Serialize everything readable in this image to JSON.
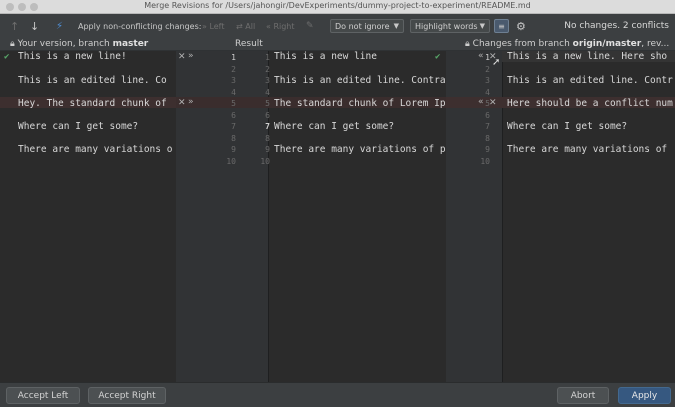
{
  "window": {
    "title": "Merge Revisions for /Users/jahongir/DevExperiments/dummy-project-to-experiment/README.md"
  },
  "toolbar": {
    "apply_non_conflicting": "Apply non-conflicting changes:",
    "left": "Left",
    "all": "All",
    "right": "Right",
    "ignore_select": "Do not ignore",
    "highlight_select": "Highlight words",
    "status": "No changes. 2 conflicts"
  },
  "headers": {
    "left_prefix": "Your version, branch ",
    "left_branch": "master",
    "center": "Result",
    "right_prefix": "Changes from branch ",
    "right_branch": "origin/master",
    "right_suffix": ", rev..."
  },
  "left_pane": {
    "lines": [
      "This is a new line!",
      "This is an edited line. Co",
      "Hey. The standard chunk of",
      "Where can I get some?",
      "There are many variations o"
    ]
  },
  "center_pane": {
    "lines": [
      "This is a new line",
      "This is an edited line. Contra",
      "The standard chunk of Lorem Ip",
      "Where can I get some?",
      "There are many variations of p"
    ]
  },
  "right_pane": {
    "lines": [
      "This is a new line. Here sho",
      "This is an edited line. Contr",
      "Here should be a conflict num",
      "Where can I get some?",
      "There are many variations of"
    ]
  },
  "gutters": {
    "left_numbers": [
      "1",
      "2",
      "3",
      "4",
      "5",
      "6",
      "7",
      "8",
      "9",
      "10"
    ],
    "center_numbers": [
      "1",
      "2",
      "3",
      "4",
      "5",
      "6",
      "7",
      "8",
      "9",
      "10"
    ],
    "right_numbers": [
      "1",
      "2",
      "3",
      "4",
      "5",
      "6",
      "7",
      "8",
      "9",
      "10"
    ]
  },
  "buttons": {
    "accept_left": "Accept Left",
    "accept_right": "Accept Right",
    "abort": "Abort",
    "apply": "Apply"
  }
}
